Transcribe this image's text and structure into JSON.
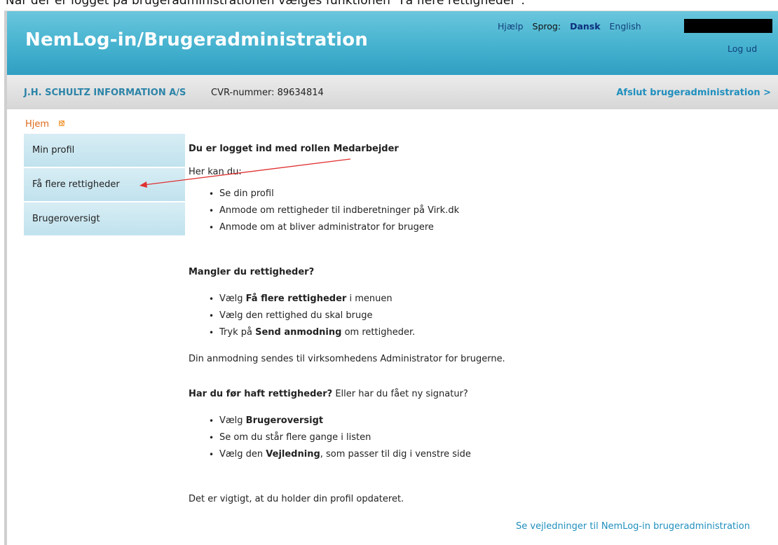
{
  "caption": "Når der er logget på brugeradministrationen vælges funktionen \"Få flere rettigheder\".",
  "header": {
    "title": "NemLog-in/Brugeradministration",
    "help": "Hjælp",
    "language_label": "Sprog:",
    "lang_dansk": "Dansk",
    "lang_english": "English",
    "logout": "Log ud"
  },
  "company_bar": {
    "name": "J.H. SCHULTZ INFORMATION A/S",
    "cvr": "CVR-nummer: 89634814",
    "exit": "Afslut brugeradministration >"
  },
  "breadcrumb": {
    "home": "Hjem",
    "icon": "rss-feed-icon"
  },
  "sidebar": {
    "items": [
      {
        "label": "Min profil"
      },
      {
        "label": "Få flere rettigheder"
      },
      {
        "label": "Brugeroversigt"
      }
    ]
  },
  "content": {
    "heading": "Du er logget ind med rollen Medarbejder",
    "intro": "Her kan du:",
    "can_do": [
      "Se din profil",
      "Anmode om rettigheder til indberetninger på Virk.dk",
      "Anmode om at bliver administrator for brugere"
    ],
    "missing_heading": "Mangler du rettigheder?",
    "missing_steps": [
      {
        "pre": "Vælg ",
        "bold": "Få flere rettigheder",
        "post": " i menuen"
      },
      {
        "pre": "Vælg den rettighed du skal bruge",
        "bold": "",
        "post": ""
      },
      {
        "pre": "Tryk på ",
        "bold": "Send anmodning",
        "post": " om rettigheder."
      }
    ],
    "request_note": "Din anmodning sendes til virksomhedens Administrator for brugerne.",
    "had_heading_bold": "Har du før haft rettigheder?",
    "had_heading_rest": " Eller har du fået ny signatur?",
    "had_steps": [
      {
        "pre": "Vælg ",
        "bold": "Brugeroversigt",
        "post": ""
      },
      {
        "pre": "Se om du står flere gange i listen",
        "bold": "",
        "post": ""
      },
      {
        "pre": "Vælg den ",
        "bold": "Vejledning",
        "post": ", som passer til dig i venstre side"
      }
    ],
    "reminder": "Det er vigtigt, at du holder din profil opdateret.",
    "guide_link": "Se vejledninger til NemLog-in brugeradministration"
  },
  "annotation": {
    "arrow_color": "#e03030"
  },
  "colors": {
    "header_gradient_top": "#6ac6dd",
    "header_gradient_bottom": "#2f9fc2",
    "link_blue": "#1f8fbe",
    "sidebar_bg": "#c8e6f0",
    "breadcrumb_orange": "#e06a1a"
  }
}
